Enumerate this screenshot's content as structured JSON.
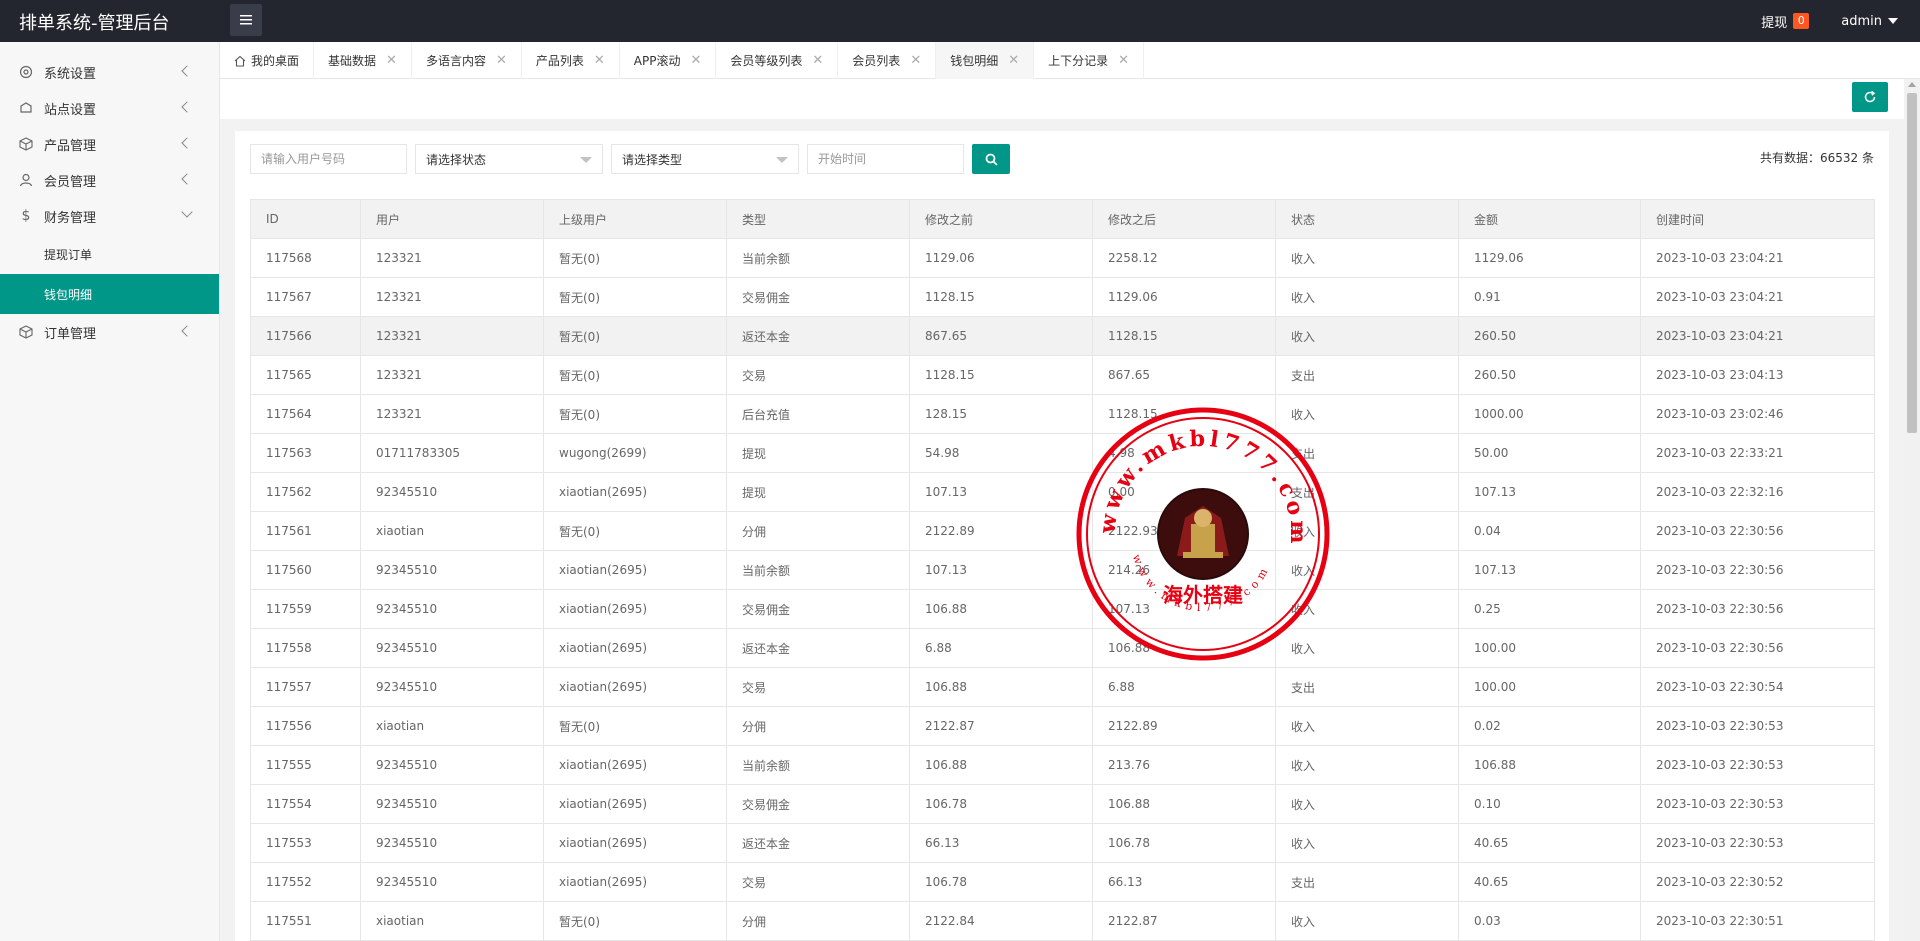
{
  "header": {
    "title": "排单系统-管理后台",
    "withdraw_label": "提现",
    "withdraw_count": "0",
    "user": "admin"
  },
  "sidebar": {
    "items": [
      {
        "label": "系统设置",
        "icon": "gear-icon"
      },
      {
        "label": "站点设置",
        "icon": "site-icon"
      },
      {
        "label": "产品管理",
        "icon": "product-icon"
      },
      {
        "label": "会员管理",
        "icon": "user-icon"
      },
      {
        "label": "财务管理",
        "icon": "dollar-icon"
      },
      {
        "label": "订单管理",
        "icon": "order-icon"
      }
    ],
    "finance_sub": [
      "提现订单",
      "钱包明细"
    ]
  },
  "tabs": [
    {
      "label": "我的桌面"
    },
    {
      "label": "基础数据"
    },
    {
      "label": "多语言内容"
    },
    {
      "label": "产品列表"
    },
    {
      "label": "APP滚动"
    },
    {
      "label": "会员等级列表"
    },
    {
      "label": "会员列表"
    },
    {
      "label": "钱包明细"
    },
    {
      "label": "上下分记录"
    }
  ],
  "filters": {
    "user_placeholder": "请输入用户号码",
    "status_placeholder": "请选择状态",
    "type_placeholder": "请选择类型",
    "time_placeholder": "开始时间"
  },
  "total_text": "共有数据：66532 条",
  "table": {
    "columns": [
      "ID",
      "用户",
      "上级用户",
      "类型",
      "修改之前",
      "修改之后",
      "状态",
      "金额",
      "创建时间"
    ],
    "rows": [
      [
        "117568",
        "123321",
        "暂无(0)",
        "当前余额",
        "1129.06",
        "2258.12",
        "收入",
        "1129.06",
        "2023-10-03 23:04:21"
      ],
      [
        "117567",
        "123321",
        "暂无(0)",
        "交易佣金",
        "1128.15",
        "1129.06",
        "收入",
        "0.91",
        "2023-10-03 23:04:21"
      ],
      [
        "117566",
        "123321",
        "暂无(0)",
        "返还本金",
        "867.65",
        "1128.15",
        "收入",
        "260.50",
        "2023-10-03 23:04:21"
      ],
      [
        "117565",
        "123321",
        "暂无(0)",
        "交易",
        "1128.15",
        "867.65",
        "支出",
        "260.50",
        "2023-10-03 23:04:13"
      ],
      [
        "117564",
        "123321",
        "暂无(0)",
        "后台充值",
        "128.15",
        "1128.15",
        "收入",
        "1000.00",
        "2023-10-03 23:02:46"
      ],
      [
        "117563",
        "01711783305",
        "wugong(2699)",
        "提现",
        "54.98",
        "4.98",
        "支出",
        "50.00",
        "2023-10-03 22:33:21"
      ],
      [
        "117562",
        "92345510",
        "xiaotian(2695)",
        "提现",
        "107.13",
        "0.00",
        "支出",
        "107.13",
        "2023-10-03 22:32:16"
      ],
      [
        "117561",
        "xiaotian",
        "暂无(0)",
        "分佣",
        "2122.89",
        "2122.93",
        "收入",
        "0.04",
        "2023-10-03 22:30:56"
      ],
      [
        "117560",
        "92345510",
        "xiaotian(2695)",
        "当前余额",
        "107.13",
        "214.26",
        "收入",
        "107.13",
        "2023-10-03 22:30:56"
      ],
      [
        "117559",
        "92345510",
        "xiaotian(2695)",
        "交易佣金",
        "106.88",
        "107.13",
        "收入",
        "0.25",
        "2023-10-03 22:30:56"
      ],
      [
        "117558",
        "92345510",
        "xiaotian(2695)",
        "返还本金",
        "6.88",
        "106.88",
        "收入",
        "100.00",
        "2023-10-03 22:30:56"
      ],
      [
        "117557",
        "92345510",
        "xiaotian(2695)",
        "交易",
        "106.88",
        "6.88",
        "支出",
        "100.00",
        "2023-10-03 22:30:54"
      ],
      [
        "117556",
        "xiaotian",
        "暂无(0)",
        "分佣",
        "2122.87",
        "2122.89",
        "收入",
        "0.02",
        "2023-10-03 22:30:53"
      ],
      [
        "117555",
        "92345510",
        "xiaotian(2695)",
        "当前余额",
        "106.88",
        "213.76",
        "收入",
        "106.88",
        "2023-10-03 22:30:53"
      ],
      [
        "117554",
        "92345510",
        "xiaotian(2695)",
        "交易佣金",
        "106.78",
        "106.88",
        "收入",
        "0.10",
        "2023-10-03 22:30:53"
      ],
      [
        "117553",
        "92345510",
        "xiaotian(2695)",
        "返还本金",
        "66.13",
        "106.78",
        "收入",
        "40.65",
        "2023-10-03 22:30:53"
      ],
      [
        "117552",
        "92345510",
        "xiaotian(2695)",
        "交易",
        "106.78",
        "66.13",
        "支出",
        "40.65",
        "2023-10-03 22:30:52"
      ],
      [
        "117551",
        "xiaotian",
        "暂无(0)",
        "分佣",
        "2122.84",
        "2122.87",
        "收入",
        "0.03",
        "2023-10-03 22:30:51"
      ]
    ]
  },
  "watermark": {
    "url_text": "www.mkbl777.com",
    "label": "海外搭建"
  },
  "colors": {
    "accent": "#009688",
    "header_bg": "#23262e",
    "badge": "#ff5722",
    "stamp": "#e60012"
  }
}
